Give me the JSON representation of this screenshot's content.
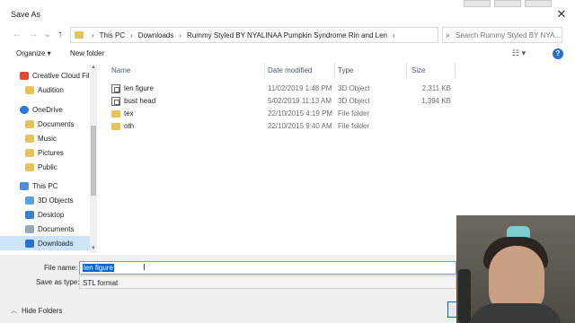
{
  "window": {
    "title": "Save As",
    "close_glyph": "✕"
  },
  "nav_buttons": {
    "back": "←",
    "forward": "→",
    "recent": "⌄",
    "up": "↑"
  },
  "address": {
    "crumbs": [
      "This PC",
      "Downloads",
      "Rummy Styled BY NYALINAA Pumpkin Syndrome Rin and Len"
    ],
    "separator": "›",
    "dropdown_glyph": "⌄",
    "refresh_glyph": "↻"
  },
  "search": {
    "placeholder": "Search Rummy Styled BY NYA...",
    "icon": "search-icon",
    "glyph": "⌕"
  },
  "toolbar": {
    "organize_label": "Organize ▾",
    "new_folder_label": "New folder",
    "view_glyph": "☷ ▾",
    "help_glyph": "?"
  },
  "nav_pane": {
    "items": [
      {
        "label": "Creative Cloud Fil",
        "icon": "creative-cloud-icon",
        "color": "#e04a2f"
      },
      {
        "label": "Audition",
        "icon": "folder-icon",
        "color": "#e8c35a"
      },
      {
        "label": "OneDrive",
        "icon": "onedrive-icon",
        "color": "#2b7bd8"
      },
      {
        "label": "Documents",
        "icon": "folder-icon",
        "color": "#e8c35a"
      },
      {
        "label": "Music",
        "icon": "folder-icon",
        "color": "#e8c35a"
      },
      {
        "label": "Pictures",
        "icon": "folder-icon",
        "color": "#e8c35a"
      },
      {
        "label": "Public",
        "icon": "folder-icon",
        "color": "#e8c35a"
      },
      {
        "label": "This PC",
        "icon": "pc-icon",
        "color": "#4a90d9"
      },
      {
        "label": "3D Objects",
        "icon": "cube-icon",
        "color": "#5aa0e0"
      },
      {
        "label": "Desktop",
        "icon": "desktop-icon",
        "color": "#3a7fcf"
      },
      {
        "label": "Documents",
        "icon": "documents-icon",
        "color": "#9aa8b8"
      },
      {
        "label": "Downloads",
        "icon": "downloads-icon",
        "color": "#2b6fcf"
      }
    ],
    "selected_index": 11
  },
  "columns": {
    "name": "Name",
    "date": "Date modified",
    "type": "Type",
    "size": "Size"
  },
  "files": [
    {
      "name": "len figure",
      "date": "11/02/2019 1:48 PM",
      "type": "3D Object",
      "size": "2,311 KB",
      "icon": "3d-object-icon"
    },
    {
      "name": "bust head",
      "date": "5/02/2019 11:13 AM",
      "type": "3D Object",
      "size": "1,394 KB",
      "icon": "3d-object-icon"
    },
    {
      "name": "tex",
      "date": "22/10/2015 4:19 PM",
      "type": "File folder",
      "size": "",
      "icon": "folder-icon"
    },
    {
      "name": "oth",
      "date": "22/10/2015 9:40 AM",
      "type": "File folder",
      "size": "",
      "icon": "folder-icon"
    }
  ],
  "form": {
    "file_name_label": "File name:",
    "file_name_value": "len figure",
    "save_as_type_label": "Save as type:",
    "save_as_type_value": "STL format"
  },
  "footer": {
    "hide_folders_label": "Hide Folders",
    "chevron_glyph": "︿"
  }
}
